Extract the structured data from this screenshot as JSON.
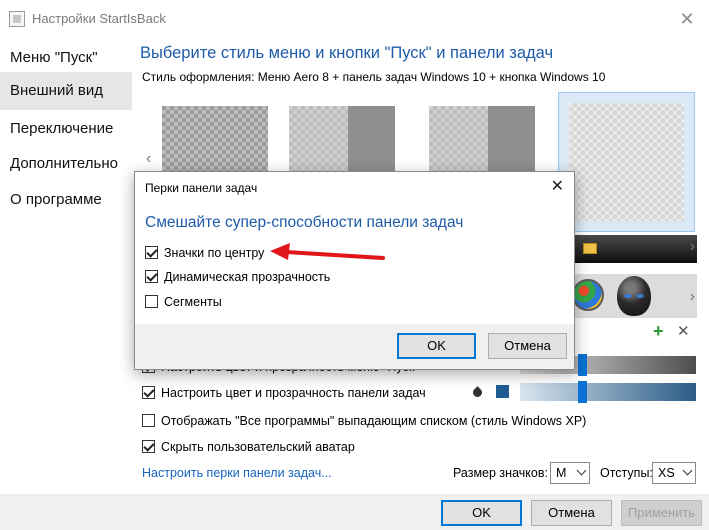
{
  "window": {
    "title": "Настройки StartIsBack",
    "close_glyph": "✕"
  },
  "sidebar": {
    "items": [
      {
        "label": "Меню \"Пуск\""
      },
      {
        "label": "Внешний вид"
      },
      {
        "label": "Переключение"
      },
      {
        "label": "Дополнительно"
      },
      {
        "label": "О программе"
      }
    ],
    "active_index": 1
  },
  "main": {
    "heading": "Выберите стиль меню и кнопки \"Пуск\" и панели задач",
    "style_line": "Стиль оформления:  Меню Aero 8 + панель задач Windows 10 + кнопка Windows 10",
    "options": {
      "start_color": "Настроить цвет и прозрачность меню \"Пуск\"",
      "taskbar_color": "Настроить цвет и прозрачность панели задач",
      "all_programs": "Отображать \"Все программы\" выпадающим списком (стиль Windows XP)",
      "hide_avatar": "Скрыть пользовательский аватар"
    },
    "checked": {
      "start_color": true,
      "taskbar_color": true,
      "all_programs": false,
      "hide_avatar": true
    },
    "link": "Настроить перки панели задач...",
    "icon_size_label": "Размер значков:",
    "icon_size_value": "M",
    "padding_label": "Отступы:",
    "padding_value": "XS",
    "accent_color": "#1f5c92",
    "icons": [
      "chevron-left-icon",
      "chevron-right-icon",
      "windows-orb-icon",
      "alien-orb-icon",
      "add-icon",
      "remove-icon",
      "transparency-drop-icon"
    ]
  },
  "footer": {
    "ok": "OK",
    "cancel": "Отмена",
    "apply": "Применить"
  },
  "dialog": {
    "title": "Перки панели задач",
    "heading": "Смешайте супер-способности панели задач",
    "options": [
      {
        "label": "Значки по центру",
        "checked": true
      },
      {
        "label": "Динамическая прозрачность",
        "checked": true
      },
      {
        "label": "Сегменты",
        "checked": false
      }
    ],
    "ok": "OK",
    "cancel": "Отмена"
  }
}
